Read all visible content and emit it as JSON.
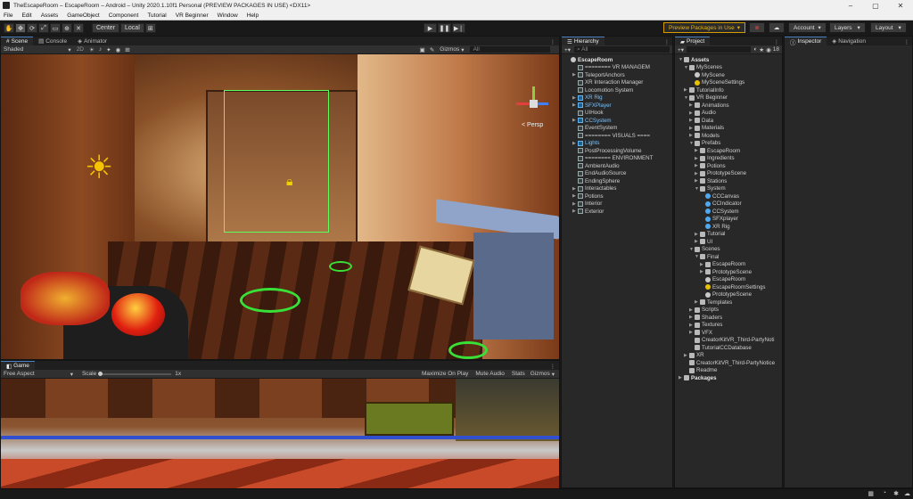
{
  "window": {
    "title": "TheEscapeRoom – EscapeRoom – Android – Unity 2020.1.10f1 Personal (PREVIEW PACKAGES IN USE) <DX11>",
    "controls": [
      "–",
      "▢",
      "✕"
    ]
  },
  "menu": [
    "File",
    "Edit",
    "Assets",
    "GameObject",
    "Component",
    "Tutorial",
    "VR Beginner",
    "Window",
    "Help"
  ],
  "toolbar": {
    "center_label": "Center",
    "local_label": "Local",
    "preview_label": "Preview Packages in Use",
    "account_label": "Account",
    "layers_label": "Layers",
    "layout_label": "Layout"
  },
  "scene_panel": {
    "tabs": [
      "Scene",
      "Console",
      "Animator"
    ],
    "shading": "Shaded",
    "gizmos": "Gizmos",
    "search": "All",
    "persp": "< Persp"
  },
  "game_panel": {
    "tab": "Game",
    "aspect": "Free Aspect",
    "scale_label": "Scale",
    "scale_value": "1x",
    "maximize": "Maximize On Play",
    "mute": "Mute Audio",
    "stats": "Stats",
    "gizmos": "Gizmos"
  },
  "hierarchy": {
    "tab": "Hierarchy",
    "search": "All",
    "items": [
      {
        "label": "EscapeRoom",
        "depth": 0,
        "icon": "scene",
        "style": "bold"
      },
      {
        "label": "======== VR MANAGEM",
        "depth": 1,
        "icon": "cube"
      },
      {
        "label": "TeleportAnchors",
        "depth": 1,
        "icon": "cube",
        "arrow": true
      },
      {
        "label": "XR Interaction Manager",
        "depth": 1,
        "icon": "cube"
      },
      {
        "label": "Locomotion System",
        "depth": 1,
        "icon": "cube"
      },
      {
        "label": "XR Rig",
        "depth": 1,
        "icon": "cubeblue",
        "style": "blue",
        "arrow": true
      },
      {
        "label": "SFXPlayer",
        "depth": 1,
        "icon": "cubeblue",
        "style": "blue",
        "arrow": true
      },
      {
        "label": "UIHook",
        "depth": 1,
        "icon": "cube"
      },
      {
        "label": "CCSystem",
        "depth": 1,
        "icon": "cubeblue",
        "style": "blue",
        "arrow": true
      },
      {
        "label": "EventSystem",
        "depth": 1,
        "icon": "cube"
      },
      {
        "label": "======== VISUALS ====",
        "depth": 1,
        "icon": "cube"
      },
      {
        "label": "Lights",
        "depth": 1,
        "icon": "cubeblue",
        "style": "blue",
        "arrow": true
      },
      {
        "label": "PostProcessingVolume",
        "depth": 1,
        "icon": "cube"
      },
      {
        "label": "======== ENVIRONMENT",
        "depth": 1,
        "icon": "cube"
      },
      {
        "label": "AmbientAudio",
        "depth": 1,
        "icon": "cube"
      },
      {
        "label": "EndAudioSource",
        "depth": 1,
        "icon": "cube"
      },
      {
        "label": "EndingSphere",
        "depth": 1,
        "icon": "cube"
      },
      {
        "label": "Interactables",
        "depth": 1,
        "icon": "cube",
        "arrow": true
      },
      {
        "label": "Potions",
        "depth": 1,
        "icon": "cube",
        "arrow": true
      },
      {
        "label": "Interior",
        "depth": 1,
        "icon": "cube",
        "arrow": true
      },
      {
        "label": "Exterior",
        "depth": 1,
        "icon": "cube",
        "arrow": true
      }
    ]
  },
  "project": {
    "tab": "Project",
    "count": "18",
    "items": [
      {
        "label": "Assets",
        "depth": 0,
        "icon": "folder",
        "style": "bold",
        "open": true
      },
      {
        "label": "MyScenes",
        "depth": 1,
        "icon": "folder",
        "open": true
      },
      {
        "label": "MyScene",
        "depth": 2,
        "icon": "scene"
      },
      {
        "label": "MySceneSettings",
        "depth": 2,
        "icon": "settings"
      },
      {
        "label": "TutorialInfo",
        "depth": 1,
        "icon": "folder",
        "arrow": true
      },
      {
        "label": "VR Beginner",
        "depth": 1,
        "icon": "folder",
        "open": true
      },
      {
        "label": "Animations",
        "depth": 2,
        "icon": "folder",
        "arrow": true
      },
      {
        "label": "Audio",
        "depth": 2,
        "icon": "folder",
        "arrow": true
      },
      {
        "label": "Data",
        "depth": 2,
        "icon": "folder",
        "arrow": true
      },
      {
        "label": "Materials",
        "depth": 2,
        "icon": "folder",
        "arrow": true
      },
      {
        "label": "Models",
        "depth": 2,
        "icon": "folder",
        "arrow": true
      },
      {
        "label": "Prefabs",
        "depth": 2,
        "icon": "folder",
        "open": true
      },
      {
        "label": "EscapeRoom",
        "depth": 3,
        "icon": "folder",
        "arrow": true
      },
      {
        "label": "Ingredients",
        "depth": 3,
        "icon": "folder",
        "arrow": true
      },
      {
        "label": "Potions",
        "depth": 3,
        "icon": "folder",
        "arrow": true
      },
      {
        "label": "PrototypeScene",
        "depth": 3,
        "icon": "folder",
        "arrow": true
      },
      {
        "label": "Stations",
        "depth": 3,
        "icon": "folder",
        "arrow": true
      },
      {
        "label": "System",
        "depth": 3,
        "icon": "folder",
        "open": true
      },
      {
        "label": "CCCanvas",
        "depth": 4,
        "icon": "prefab"
      },
      {
        "label": "CCIndicator",
        "depth": 4,
        "icon": "prefab"
      },
      {
        "label": "CCSystem",
        "depth": 4,
        "icon": "prefab"
      },
      {
        "label": "SFXplayer",
        "depth": 4,
        "icon": "prefab"
      },
      {
        "label": "XR Rig",
        "depth": 4,
        "icon": "prefab"
      },
      {
        "label": "Tutorial",
        "depth": 3,
        "icon": "folder",
        "arrow": true
      },
      {
        "label": "UI",
        "depth": 3,
        "icon": "folder",
        "arrow": true
      },
      {
        "label": "Scenes",
        "depth": 2,
        "icon": "folder",
        "open": true
      },
      {
        "label": "Final",
        "depth": 3,
        "icon": "folder",
        "open": true
      },
      {
        "label": "EscapeRoom",
        "depth": 4,
        "icon": "folder",
        "arrow": true
      },
      {
        "label": "PrototypeScene",
        "depth": 4,
        "icon": "folder",
        "arrow": true
      },
      {
        "label": "EscapeRoom",
        "depth": 4,
        "icon": "scene"
      },
      {
        "label": "EscapeRoomSettings",
        "depth": 4,
        "icon": "settings"
      },
      {
        "label": "PrototypeScene",
        "depth": 4,
        "icon": "scene"
      },
      {
        "label": "Templates",
        "depth": 3,
        "icon": "folder",
        "arrow": true
      },
      {
        "label": "Scripts",
        "depth": 2,
        "icon": "folder",
        "arrow": true
      },
      {
        "label": "Shaders",
        "depth": 2,
        "icon": "folder",
        "arrow": true
      },
      {
        "label": "Textures",
        "depth": 2,
        "icon": "folder",
        "arrow": true
      },
      {
        "label": "VFX",
        "depth": 2,
        "icon": "folder",
        "arrow": true
      },
      {
        "label": "CreatorKitVR_Third-PartyNoti",
        "depth": 2,
        "icon": "doc"
      },
      {
        "label": "TutorialCCDatabase",
        "depth": 2,
        "icon": "doc"
      },
      {
        "label": "XR",
        "depth": 1,
        "icon": "folder",
        "arrow": true
      },
      {
        "label": "CreatorKitVR_Third-PartyNotice",
        "depth": 1,
        "icon": "doc"
      },
      {
        "label": "Readme",
        "depth": 1,
        "icon": "doc"
      },
      {
        "label": "Packages",
        "depth": 0,
        "icon": "folder",
        "style": "bold",
        "arrow": true
      }
    ]
  },
  "inspector": {
    "tabs": [
      "Inspector",
      "Navigation"
    ]
  },
  "colors": {
    "accent": "#4a82c4",
    "preview_outline": "#d39b00",
    "prefab_blue": "#7ac3ff"
  }
}
